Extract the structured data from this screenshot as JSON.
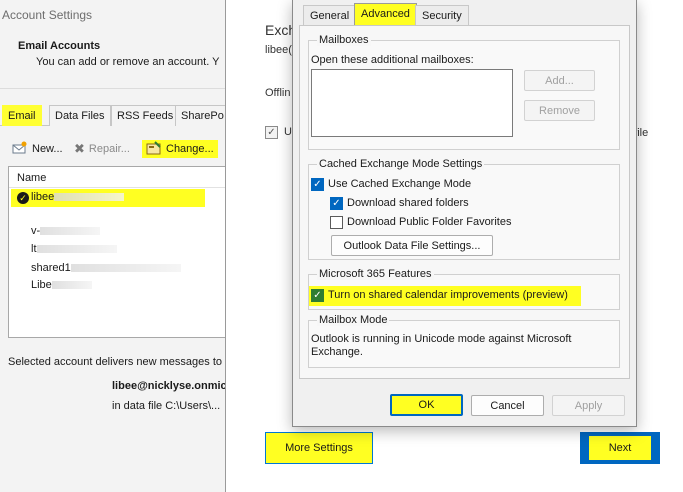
{
  "account_settings": {
    "window_title": "Account Settings",
    "heading": "Email Accounts",
    "subtext": "You can add or remove an account. Y",
    "tabs": [
      "Email",
      "Data Files",
      "RSS Feeds",
      "SharePo"
    ],
    "toolbar": {
      "new": "New...",
      "repair": "Repair...",
      "change": "Change..."
    },
    "list_header": "Name",
    "rows": [
      "libee",
      "v-",
      "lt",
      "shared1",
      "Libe"
    ],
    "footer_text": "Selected account delivers new messages to",
    "footer_account": "libee@nicklyse.onmic",
    "footer_datafile": "in data file C:\\Users\\..."
  },
  "exchange": {
    "title": "Exch",
    "line": "libee(",
    "offline": "Offlin",
    "use_label": "Us",
    "a_file": "a file",
    "more_settings": "More Settings",
    "next": "Next"
  },
  "dialog": {
    "tabs": {
      "general": "General",
      "advanced": "Advanced",
      "security": "Security"
    },
    "mailboxes": {
      "legend": "Mailboxes",
      "open_label": "Open these additional mailboxes:",
      "add": "Add...",
      "remove": "Remove"
    },
    "cached": {
      "legend": "Cached Exchange Mode Settings",
      "use_cached": "Use Cached Exchange Mode",
      "download_shared": "Download shared folders",
      "download_public": "Download Public Folder Favorites",
      "data_file_settings": "Outlook Data File Settings..."
    },
    "m365": {
      "legend": "Microsoft 365 Features",
      "shared_calendar": "Turn on shared calendar improvements (preview)"
    },
    "mailbox_mode": {
      "legend": "Mailbox Mode",
      "text_line1": "Outlook is running in Unicode mode against Microsoft",
      "text_line2": "Exchange."
    },
    "buttons": {
      "ok": "OK",
      "cancel": "Cancel",
      "apply": "Apply"
    }
  },
  "colors": {
    "highlight": "#ffff22",
    "accent": "#0067c0"
  }
}
